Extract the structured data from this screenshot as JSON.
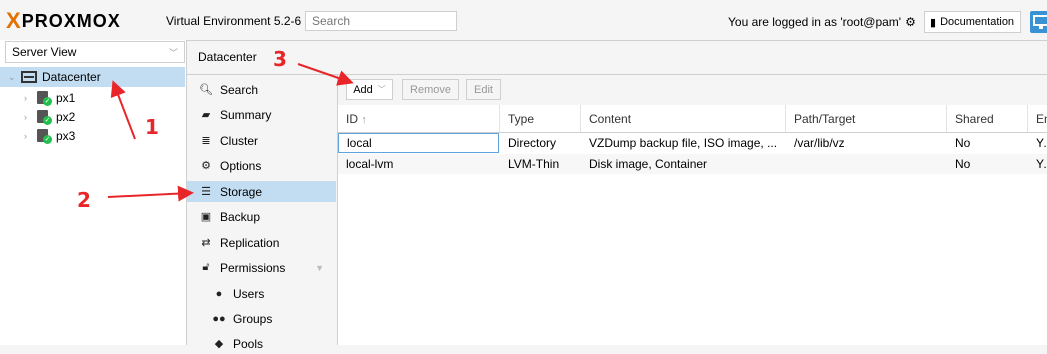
{
  "header": {
    "logo_x": "X",
    "logo_text": "PROXMOX",
    "version": "Virtual Environment 5.2-6",
    "search_placeholder": "Search",
    "login_text": "You are logged in as 'root@pam'",
    "documentation_label": "Documentation"
  },
  "tree": {
    "view_label": "Server View",
    "root": "Datacenter",
    "nodes": [
      "px1",
      "px2",
      "px3"
    ]
  },
  "main": {
    "title": "Datacenter"
  },
  "menu": {
    "items": [
      {
        "label": "Search",
        "icon": "search-icon"
      },
      {
        "label": "Summary",
        "icon": "book-icon"
      },
      {
        "label": "Cluster",
        "icon": "server-icon"
      },
      {
        "label": "Options",
        "icon": "gear-icon"
      },
      {
        "label": "Storage",
        "icon": "database-icon"
      },
      {
        "label": "Backup",
        "icon": "floppy-icon"
      },
      {
        "label": "Replication",
        "icon": "retweet-icon"
      },
      {
        "label": "Permissions",
        "icon": "unlock-icon"
      },
      {
        "label": "Users",
        "icon": "user-icon"
      },
      {
        "label": "Groups",
        "icon": "users-icon"
      },
      {
        "label": "Pools",
        "icon": "tags-icon"
      }
    ]
  },
  "toolbar": {
    "add_label": "Add",
    "remove_label": "Remove",
    "edit_label": "Edit"
  },
  "grid": {
    "columns": [
      "ID",
      "Type",
      "Content",
      "Path/Target",
      "Shared",
      "En"
    ],
    "rows": [
      {
        "id": "local",
        "type": "Directory",
        "content": "VZDump backup file, ISO image, ...",
        "path": "/var/lib/vz",
        "shared": "No",
        "enabled": "Ye"
      },
      {
        "id": "local-lvm",
        "type": "LVM-Thin",
        "content": "Disk image, Container",
        "path": "",
        "shared": "No",
        "enabled": "Ye"
      }
    ]
  },
  "annotations": {
    "one": "1",
    "two": "2",
    "three": "3",
    "color": "#e8262a"
  },
  "colors": {
    "selection": "#c2ddf2",
    "brand_orange": "#e57000",
    "status_ok": "#21bf4b"
  }
}
